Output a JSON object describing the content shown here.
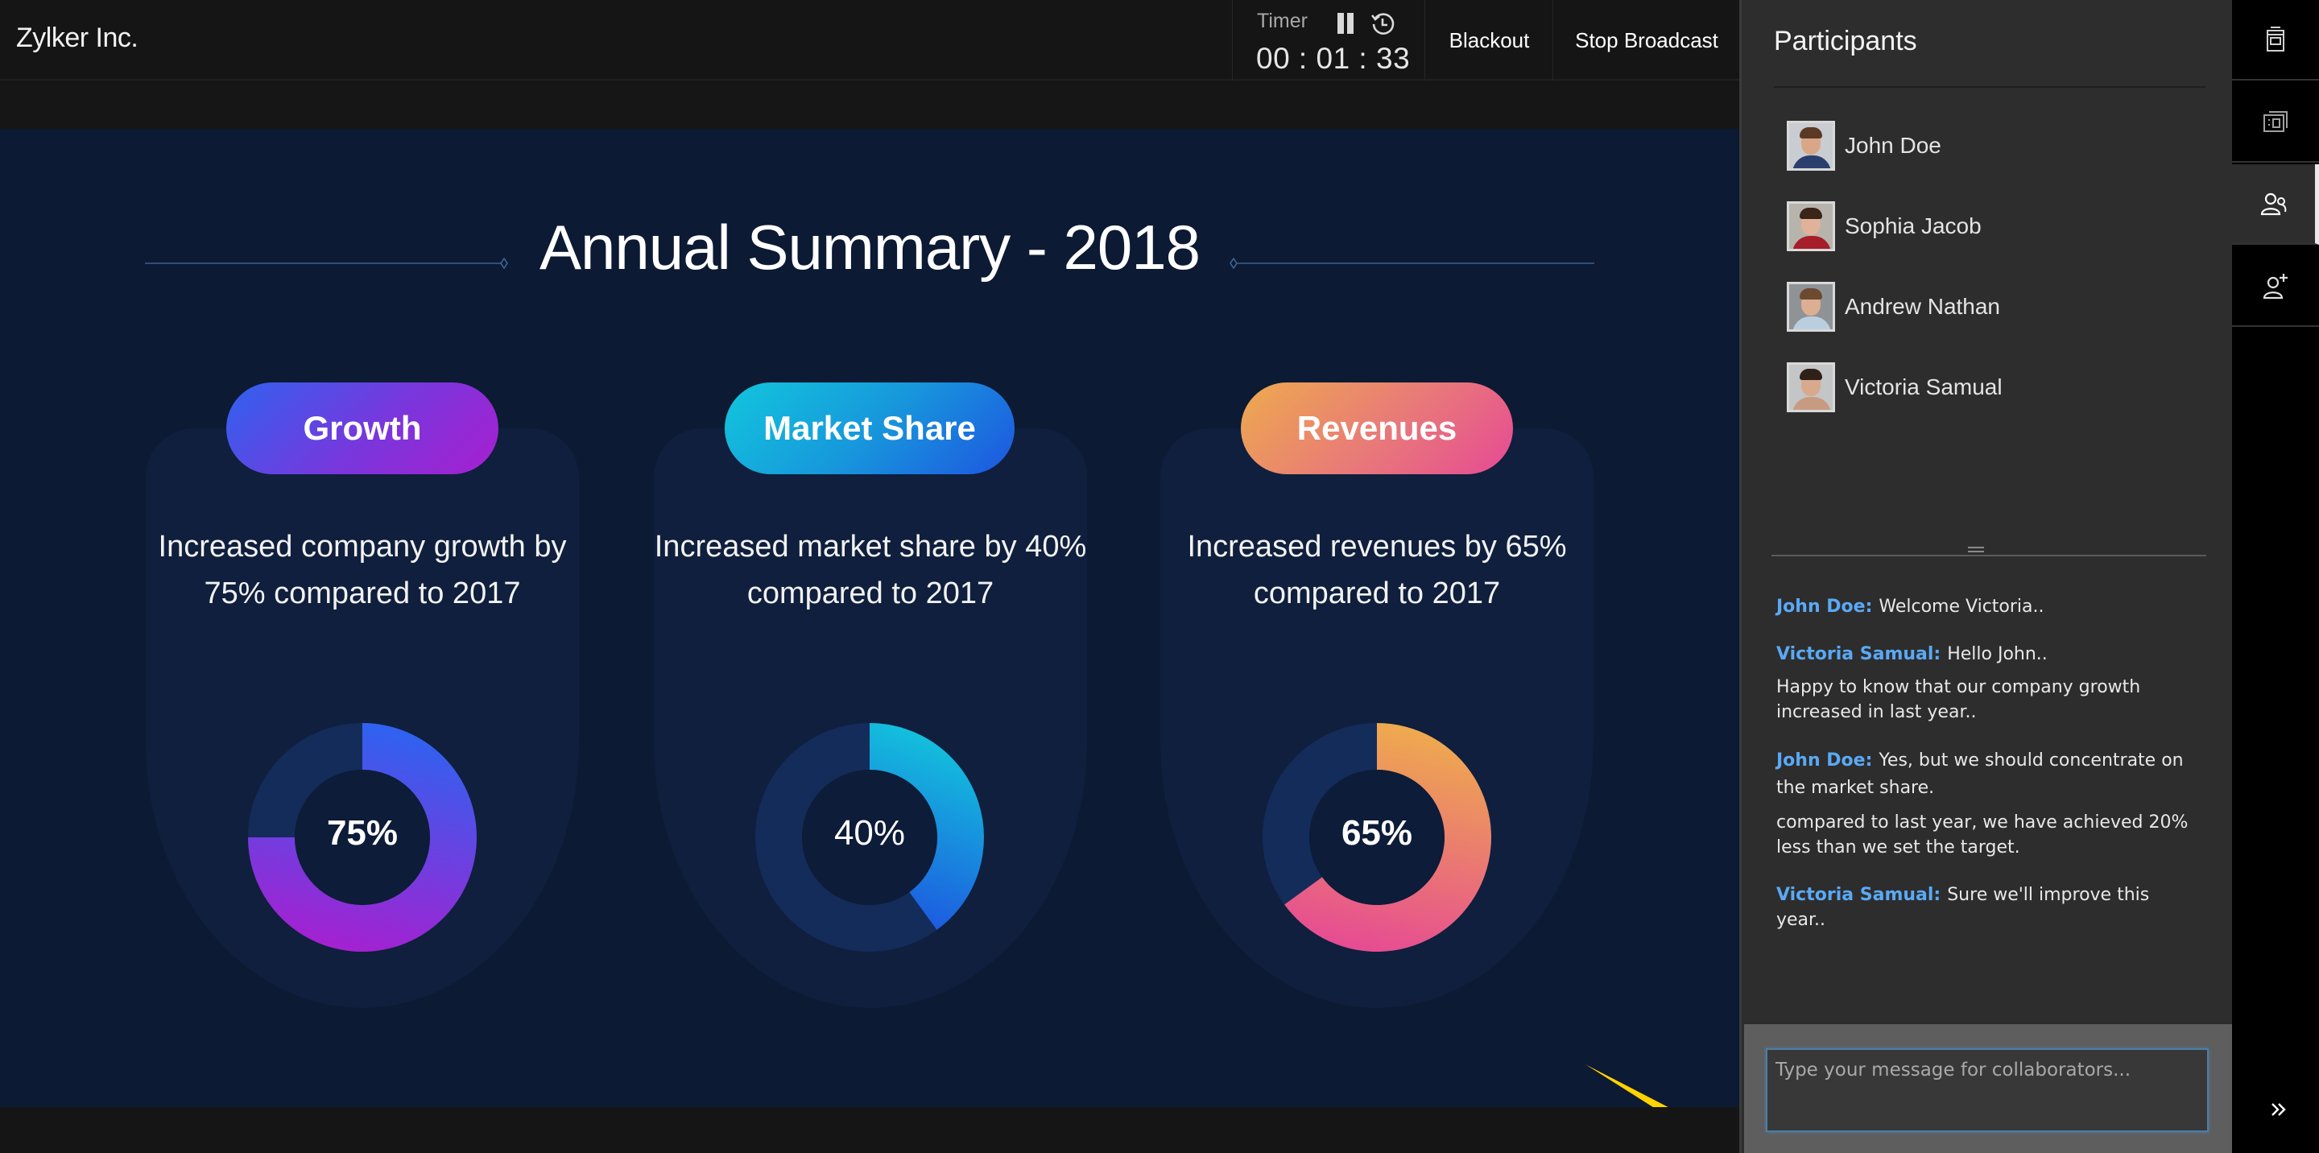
{
  "header": {
    "brand": "Zylker Inc.",
    "timer_label": "Timer",
    "timer_value": "00 : 01 : 33",
    "blackout_label": "Blackout",
    "stop_broadcast_label": "Stop Broadcast"
  },
  "slide": {
    "title": "Annual Summary - 2018",
    "cards": [
      {
        "label": "Growth",
        "description": "Increased company growth by 75% compared to 2017",
        "value_label": "75%"
      },
      {
        "label": "Market Share",
        "description": "Increased market share by 40% compared to 2017",
        "value_label": "40%"
      },
      {
        "label": "Revenues",
        "description": "Increased revenues by 65% compared to 2017",
        "value_label": "65%"
      }
    ]
  },
  "chart_data": {
    "type": "pie",
    "title": "Annual Summary - 2018",
    "charts": [
      {
        "name": "Growth",
        "value": 75,
        "max": 100,
        "colors": [
          "#2f62f0",
          "#a81fd0"
        ],
        "track_color": "#142c5a"
      },
      {
        "name": "Market Share",
        "value": 40,
        "max": 100,
        "colors": [
          "#12c6dc",
          "#1e55e0"
        ],
        "track_color": "#142c5a"
      },
      {
        "name": "Revenues",
        "value": 65,
        "max": 100,
        "colors": [
          "#eeaa4e",
          "#e64a94"
        ],
        "track_color": "#142c5a"
      }
    ]
  },
  "panel": {
    "title": "Participants",
    "participants": [
      {
        "name": "John Doe"
      },
      {
        "name": "Sophia Jacob"
      },
      {
        "name": "Andrew Nathan"
      },
      {
        "name": "Victoria Samual"
      }
    ],
    "chat": [
      {
        "sender": "John Doe:",
        "text": "Welcome Victoria..",
        "continuation": ""
      },
      {
        "sender": "Victoria Samual:",
        "text": "Hello John..",
        "continuation": "Happy to know that our company growth increased in last year.."
      },
      {
        "sender": "John Doe:",
        "text": "Yes, but we should concentrate on the market share.",
        "continuation": "compared to last year, we have achieved 20% less than we set the target."
      },
      {
        "sender": "Victoria Samual:",
        "text": "Sure we'll improve this year..",
        "continuation": ""
      }
    ],
    "compose_placeholder": "Type your message for collaborators...",
    "compose_value": ""
  },
  "toolstrip": {
    "items": [
      {
        "icon": "slides-icon",
        "active": false
      },
      {
        "icon": "notes-icon",
        "active": false
      },
      {
        "icon": "participants-icon",
        "active": true
      },
      {
        "icon": "add-participant-icon",
        "active": false
      }
    ],
    "collapse_icon": "double-chevron-right-icon"
  },
  "colors": {
    "slide_bg": "#0c1a33",
    "card_bg": "#0f1f3d",
    "chat_sender": "#5aa9f5",
    "pointer_arrow": "#ffd200"
  }
}
